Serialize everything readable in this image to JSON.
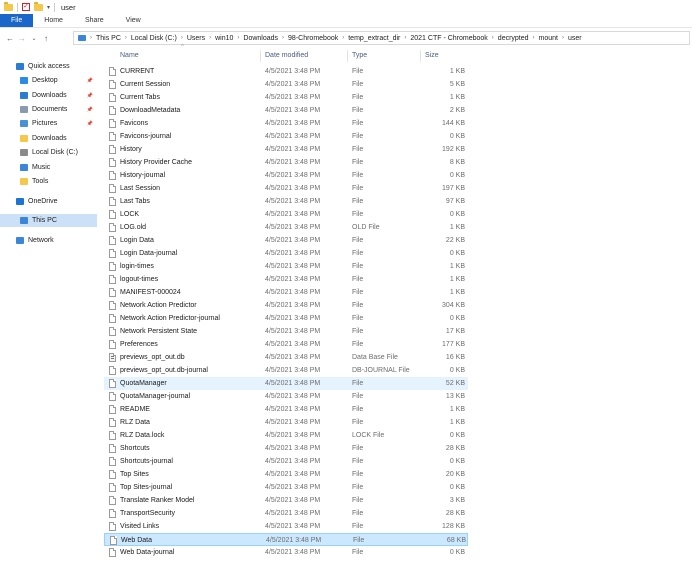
{
  "window": {
    "title": "user"
  },
  "ribbon": {
    "tabs": [
      "File",
      "Home",
      "Share",
      "View"
    ]
  },
  "address": {
    "crumbs": [
      "This PC",
      "Local Disk (C:)",
      "Users",
      "win10",
      "Downloads",
      "98-Chromebook",
      "temp_extract_dir",
      "2021 CTF - Chromebook",
      "decrypted",
      "mount",
      "user"
    ]
  },
  "sidebar": {
    "items": [
      {
        "label": "Quick access",
        "icon": "star-icon",
        "color": "#2b7cd3"
      },
      {
        "label": "Desktop",
        "icon": "desktop-icon",
        "color": "#2b8ae3"
      },
      {
        "label": "Downloads",
        "icon": "downloads-icon",
        "color": "#2b7cd3"
      },
      {
        "label": "Documents",
        "icon": "documents-icon",
        "color": "#8a9bb0"
      },
      {
        "label": "Pictures",
        "icon": "pictures-icon",
        "color": "#4a90d9"
      },
      {
        "label": "Downloads",
        "icon": "folder-icon",
        "color": "#f4c84a"
      },
      {
        "label": "Local Disk (C:)",
        "icon": "drive-icon",
        "color": "#8a8a8a"
      },
      {
        "label": "Music",
        "icon": "music-icon",
        "color": "#3b86d8"
      },
      {
        "label": "Tools",
        "icon": "folder-icon",
        "color": "#f4c84a"
      },
      {
        "label": "OneDrive",
        "icon": "onedrive-icon",
        "color": "#1e73d6"
      },
      {
        "label": "This PC",
        "icon": "pc-icon",
        "color": "#3b86d8"
      },
      {
        "label": "Network",
        "icon": "network-icon",
        "color": "#3b86d8"
      }
    ]
  },
  "columns": {
    "name": "Name",
    "date": "Date modified",
    "type": "Type",
    "size": "Size"
  },
  "files": [
    {
      "name": "CURRENT",
      "date": "4/5/2021 3:48 PM",
      "type": "File",
      "size": "1 KB"
    },
    {
      "name": "Current Session",
      "date": "4/5/2021 3:48 PM",
      "type": "File",
      "size": "5 KB"
    },
    {
      "name": "Current Tabs",
      "date": "4/5/2021 3:48 PM",
      "type": "File",
      "size": "1 KB"
    },
    {
      "name": "DownloadMetadata",
      "date": "4/5/2021 3:48 PM",
      "type": "File",
      "size": "2 KB"
    },
    {
      "name": "Favicons",
      "date": "4/5/2021 3:48 PM",
      "type": "File",
      "size": "144 KB"
    },
    {
      "name": "Favicons-journal",
      "date": "4/5/2021 3:48 PM",
      "type": "File",
      "size": "0 KB"
    },
    {
      "name": "History",
      "date": "4/5/2021 3:48 PM",
      "type": "File",
      "size": "192 KB"
    },
    {
      "name": "History Provider Cache",
      "date": "4/5/2021 3:48 PM",
      "type": "File",
      "size": "8 KB"
    },
    {
      "name": "History-journal",
      "date": "4/5/2021 3:48 PM",
      "type": "File",
      "size": "0 KB"
    },
    {
      "name": "Last Session",
      "date": "4/5/2021 3:48 PM",
      "type": "File",
      "size": "197 KB"
    },
    {
      "name": "Last Tabs",
      "date": "4/5/2021 3:48 PM",
      "type": "File",
      "size": "97 KB"
    },
    {
      "name": "LOCK",
      "date": "4/5/2021 3:48 PM",
      "type": "File",
      "size": "0 KB"
    },
    {
      "name": "LOG.old",
      "date": "4/5/2021 3:48 PM",
      "type": "OLD File",
      "size": "1 KB"
    },
    {
      "name": "Login Data",
      "date": "4/5/2021 3:48 PM",
      "type": "File",
      "size": "22 KB"
    },
    {
      "name": "Login Data-journal",
      "date": "4/5/2021 3:48 PM",
      "type": "File",
      "size": "0 KB"
    },
    {
      "name": "login-times",
      "date": "4/5/2021 3:48 PM",
      "type": "File",
      "size": "1 KB"
    },
    {
      "name": "logout-times",
      "date": "4/5/2021 3:48 PM",
      "type": "File",
      "size": "1 KB"
    },
    {
      "name": "MANIFEST-000024",
      "date": "4/5/2021 3:48 PM",
      "type": "File",
      "size": "1 KB"
    },
    {
      "name": "Network Action Predictor",
      "date": "4/5/2021 3:48 PM",
      "type": "File",
      "size": "304 KB"
    },
    {
      "name": "Network Action Predictor-journal",
      "date": "4/5/2021 3:48 PM",
      "type": "File",
      "size": "0 KB"
    },
    {
      "name": "Network Persistent State",
      "date": "4/5/2021 3:48 PM",
      "type": "File",
      "size": "17 KB"
    },
    {
      "name": "Preferences",
      "date": "4/5/2021 3:48 PM",
      "type": "File",
      "size": "177 KB"
    },
    {
      "name": "previews_opt_out.db",
      "date": "4/5/2021 3:48 PM",
      "type": "Data Base File",
      "size": "16 KB",
      "db": true
    },
    {
      "name": "previews_opt_out.db-journal",
      "date": "4/5/2021 3:48 PM",
      "type": "DB-JOURNAL File",
      "size": "0 KB"
    },
    {
      "name": "QuotaManager",
      "date": "4/5/2021 3:48 PM",
      "type": "File",
      "size": "52 KB",
      "state": "hover"
    },
    {
      "name": "QuotaManager-journal",
      "date": "4/5/2021 3:48 PM",
      "type": "File",
      "size": "13 KB"
    },
    {
      "name": "README",
      "date": "4/5/2021 3:48 PM",
      "type": "File",
      "size": "1 KB"
    },
    {
      "name": "RLZ Data",
      "date": "4/5/2021 3:48 PM",
      "type": "File",
      "size": "1 KB"
    },
    {
      "name": "RLZ Data.lock",
      "date": "4/5/2021 3:48 PM",
      "type": "LOCK File",
      "size": "0 KB"
    },
    {
      "name": "Shortcuts",
      "date": "4/5/2021 3:48 PM",
      "type": "File",
      "size": "28 KB"
    },
    {
      "name": "Shortcuts-journal",
      "date": "4/5/2021 3:48 PM",
      "type": "File",
      "size": "0 KB"
    },
    {
      "name": "Top Sites",
      "date": "4/5/2021 3:48 PM",
      "type": "File",
      "size": "20 KB"
    },
    {
      "name": "Top Sites-journal",
      "date": "4/5/2021 3:48 PM",
      "type": "File",
      "size": "0 KB"
    },
    {
      "name": "Translate Ranker Model",
      "date": "4/5/2021 3:48 PM",
      "type": "File",
      "size": "3 KB"
    },
    {
      "name": "TransportSecurity",
      "date": "4/5/2021 3:48 PM",
      "type": "File",
      "size": "28 KB"
    },
    {
      "name": "Visited Links",
      "date": "4/5/2021 3:48 PM",
      "type": "File",
      "size": "128 KB"
    },
    {
      "name": "Web Data",
      "date": "4/5/2021 3:48 PM",
      "type": "File",
      "size": "68 KB",
      "state": "selected"
    },
    {
      "name": "Web Data-journal",
      "date": "4/5/2021 3:48 PM",
      "type": "File",
      "size": "0 KB"
    }
  ]
}
